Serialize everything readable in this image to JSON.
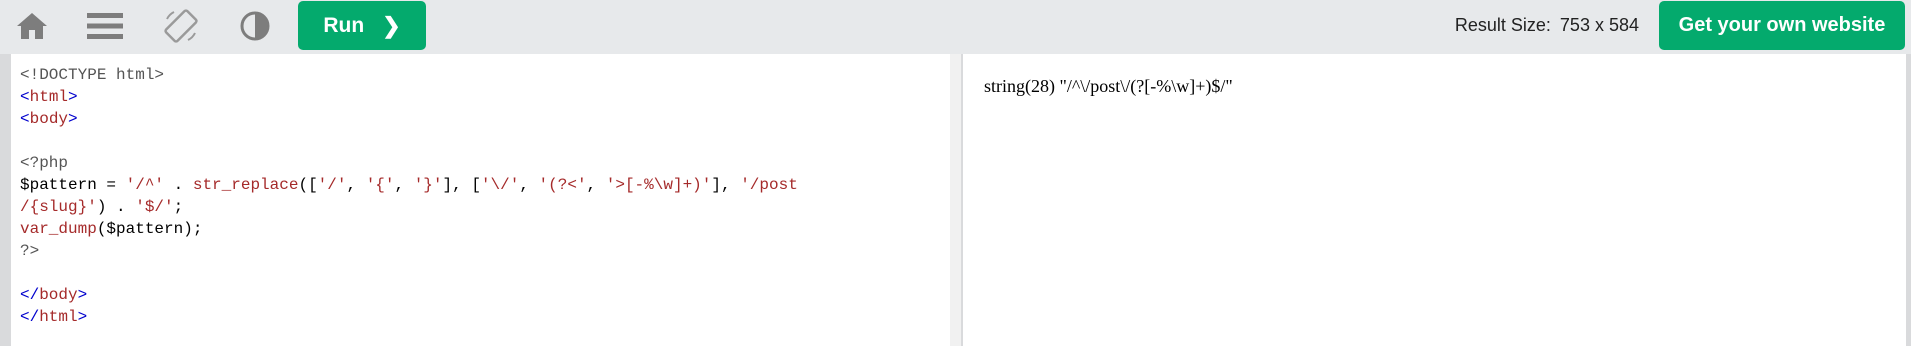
{
  "toolbar": {
    "home_icon": "home-icon",
    "menu_icon": "menu-icon",
    "rotate_icon": "rotate-icon",
    "theme_icon": "contrast-icon",
    "run_label": "Run",
    "run_chevron": "❯",
    "result_size_label": "Result Size:",
    "result_size_value": "753 x 584",
    "own_website_label": "Get your own website",
    "accent_color": "#04aa6d"
  },
  "editor": {
    "lines": [
      {
        "parts": [
          {
            "t": "<!DOCTYPE html>",
            "c": "php"
          }
        ]
      },
      {
        "parts": [
          {
            "t": "<",
            "c": "tag"
          },
          {
            "t": "html",
            "c": "tn"
          },
          {
            "t": ">",
            "c": "tag"
          }
        ]
      },
      {
        "parts": [
          {
            "t": "<",
            "c": "tag"
          },
          {
            "t": "body",
            "c": "tn"
          },
          {
            "t": ">",
            "c": "tag"
          }
        ]
      },
      {
        "parts": [
          {
            "t": "",
            "c": "var"
          }
        ]
      },
      {
        "parts": [
          {
            "t": "<?php",
            "c": "php"
          }
        ]
      },
      {
        "parts": [
          {
            "t": "$pattern = ",
            "c": "var"
          },
          {
            "t": "'/^'",
            "c": "str"
          },
          {
            "t": " . ",
            "c": "var"
          },
          {
            "t": "str_replace",
            "c": "fn"
          },
          {
            "t": "([",
            "c": "var"
          },
          {
            "t": "'/'",
            "c": "str"
          },
          {
            "t": ", ",
            "c": "var"
          },
          {
            "t": "'{'",
            "c": "str"
          },
          {
            "t": ", ",
            "c": "var"
          },
          {
            "t": "'}'",
            "c": "str"
          },
          {
            "t": "], [",
            "c": "var"
          },
          {
            "t": "'\\/'",
            "c": "str"
          },
          {
            "t": ", ",
            "c": "var"
          },
          {
            "t": "'(?<'",
            "c": "str"
          },
          {
            "t": ", ",
            "c": "var"
          },
          {
            "t": "'>[-%\\w]+)'",
            "c": "str"
          },
          {
            "t": "], ",
            "c": "var"
          },
          {
            "t": "'/post",
            "c": "str"
          }
        ]
      },
      {
        "parts": [
          {
            "t": "/{slug}'",
            "c": "str"
          },
          {
            "t": ") . ",
            "c": "var"
          },
          {
            "t": "'$/'",
            "c": "str"
          },
          {
            "t": ";",
            "c": "var"
          }
        ]
      },
      {
        "parts": [
          {
            "t": "var_dump",
            "c": "fn"
          },
          {
            "t": "($pattern);",
            "c": "var"
          }
        ]
      },
      {
        "parts": [
          {
            "t": "?>",
            "c": "php"
          }
        ]
      },
      {
        "parts": [
          {
            "t": "",
            "c": "var"
          }
        ]
      },
      {
        "parts": [
          {
            "t": "</",
            "c": "tag"
          },
          {
            "t": "body",
            "c": "tn"
          },
          {
            "t": ">",
            "c": "tag"
          }
        ]
      },
      {
        "parts": [
          {
            "t": "</",
            "c": "tag"
          },
          {
            "t": "html",
            "c": "tn"
          },
          {
            "t": ">",
            "c": "tag"
          }
        ]
      }
    ]
  },
  "result": {
    "output": "string(28) \"/^\\/post\\/(?[-%\\w]+)$/\""
  }
}
